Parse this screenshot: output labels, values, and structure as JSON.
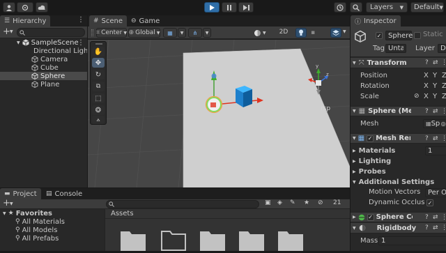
{
  "toolbar": {
    "play_icon": "play-icon",
    "pause_icon": "pause-icon",
    "step_icon": "step-icon",
    "layers_label": "Layers",
    "layout_label": "Default"
  },
  "hierarchy": {
    "tab_label": "Hierarchy",
    "scene_name": "SampleScene",
    "items": [
      "Directional Light",
      "Camera",
      "Cube",
      "Sphere",
      "Plane"
    ],
    "selected_index": 3
  },
  "scene": {
    "tab_scene": "Scene",
    "tab_game": "Game",
    "pivot_label": "Center",
    "space_label": "Global",
    "mode_2d": "2D",
    "persp_label": "rsp"
  },
  "inspector": {
    "tab_label": "Inspector",
    "object_name": "Sphere",
    "static_label": "Static",
    "tag_label": "Tag",
    "tag_value": "Untagged",
    "layer_label": "Layer",
    "layer_value": "Default",
    "transform": {
      "title": "Transform",
      "rows": [
        "Position",
        "Rotation",
        "Scale"
      ],
      "axes": [
        "X",
        "Y",
        "Z"
      ]
    },
    "mesh_filter": {
      "title": "Sphere (Mesh Filter)",
      "mesh_label": "Mesh",
      "mesh_value": "Sphere"
    },
    "mesh_renderer": {
      "title": "Mesh Renderer",
      "materials_label": "Materials",
      "materials_count": "1",
      "lighting_label": "Lighting",
      "probes_label": "Probes",
      "additional_label": "Additional Settings",
      "motion_label": "Motion Vectors",
      "motion_value": "Per Object Motion",
      "occlusion_label": "Dynamic Occlusion"
    },
    "sphere_collider": {
      "title": "Sphere Collider"
    },
    "rigidbody": {
      "title": "Rigidbody",
      "mass_label": "Mass",
      "mass_value": "1"
    }
  },
  "project": {
    "tab_project": "Project",
    "tab_console": "Console",
    "favorites_label": "Favorites",
    "favorites": [
      "All Materials",
      "All Models",
      "All Prefabs"
    ],
    "assets_label": "Assets",
    "hidden_count": "21"
  }
}
